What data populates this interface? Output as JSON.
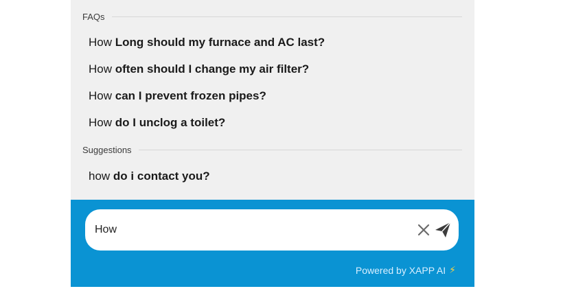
{
  "faqs": {
    "header": "FAQs",
    "items": [
      {
        "prefix": "How",
        "rest": "Long should my furnace and AC last?"
      },
      {
        "prefix": "How",
        "rest": "often should I change my air filter?"
      },
      {
        "prefix": "How",
        "rest": "can I prevent frozen pipes?"
      },
      {
        "prefix": "How",
        "rest": "do I unclog a toilet?"
      }
    ]
  },
  "suggestions": {
    "header": "Suggestions",
    "items": [
      {
        "prefix": "how",
        "rest": "do i contact you?"
      }
    ]
  },
  "input": {
    "value": "How",
    "clear_icon": "close-icon",
    "send_icon": "paper-plane-icon"
  },
  "footer": {
    "powered_by": "Powered by XAPP AI",
    "bolt_icon": "lightning-icon"
  },
  "colors": {
    "panel_bg": "#f0f0f0",
    "footer_bg": "#0a93d3",
    "text": "#1a1a1a",
    "bolt": "#ffd23f"
  }
}
